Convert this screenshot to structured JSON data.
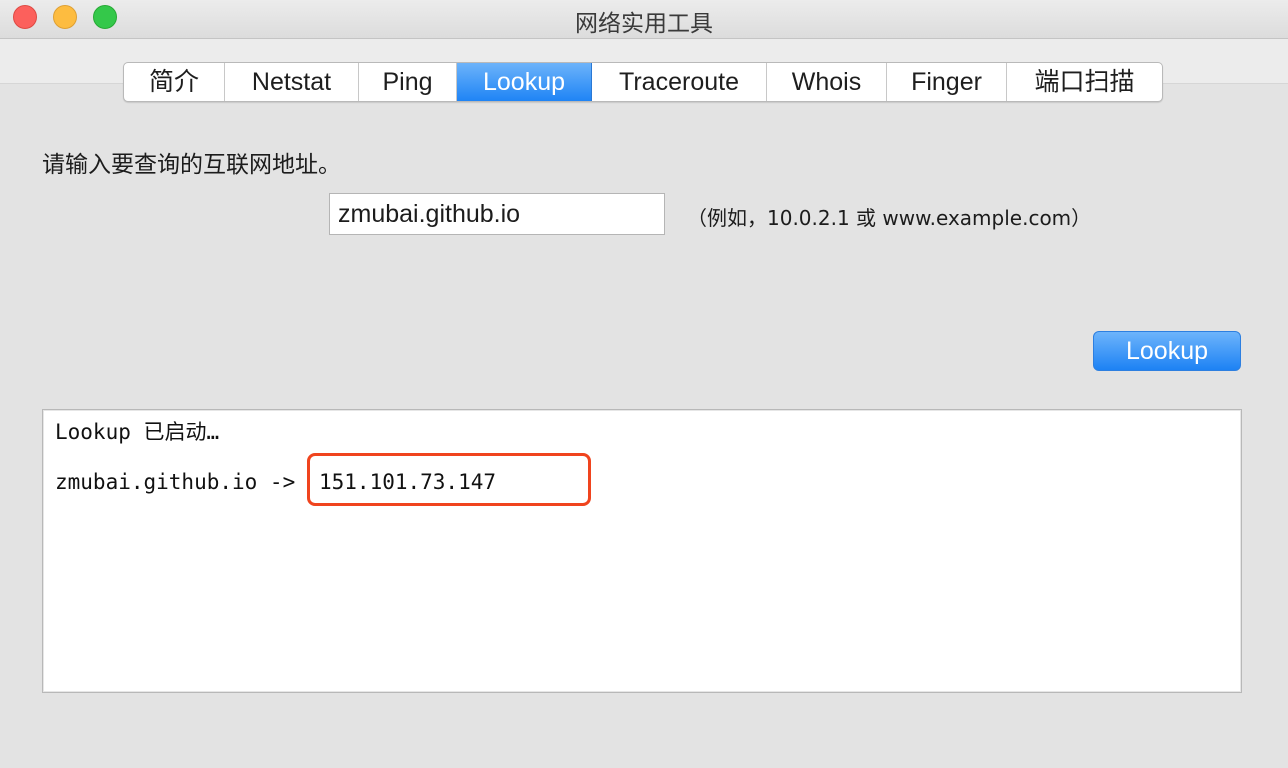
{
  "window": {
    "title": "网络实用工具"
  },
  "tabs": [
    {
      "label": "简介",
      "active": false
    },
    {
      "label": "Netstat",
      "active": false
    },
    {
      "label": "Ping",
      "active": false
    },
    {
      "label": "Lookup",
      "active": true
    },
    {
      "label": "Traceroute",
      "active": false
    },
    {
      "label": "Whois",
      "active": false
    },
    {
      "label": "Finger",
      "active": false
    },
    {
      "label": "端口扫描",
      "active": false
    }
  ],
  "lookup": {
    "prompt": "请输入要查询的互联网地址。",
    "address_value": "zmubai.github.io",
    "hint": "（例如，10.0.2.1 或 www.example.com）",
    "button_label": "Lookup"
  },
  "output": {
    "line1": "Lookup 已启动…",
    "line2_prefix": "zmubai.github.io ->",
    "ip": "151.101.73.147",
    "highlight_color": "#f0441e"
  },
  "colors": {
    "accent": "#1f84f5",
    "close": "#fc605c",
    "minimize": "#fdbc40",
    "maximize": "#34c84a"
  }
}
